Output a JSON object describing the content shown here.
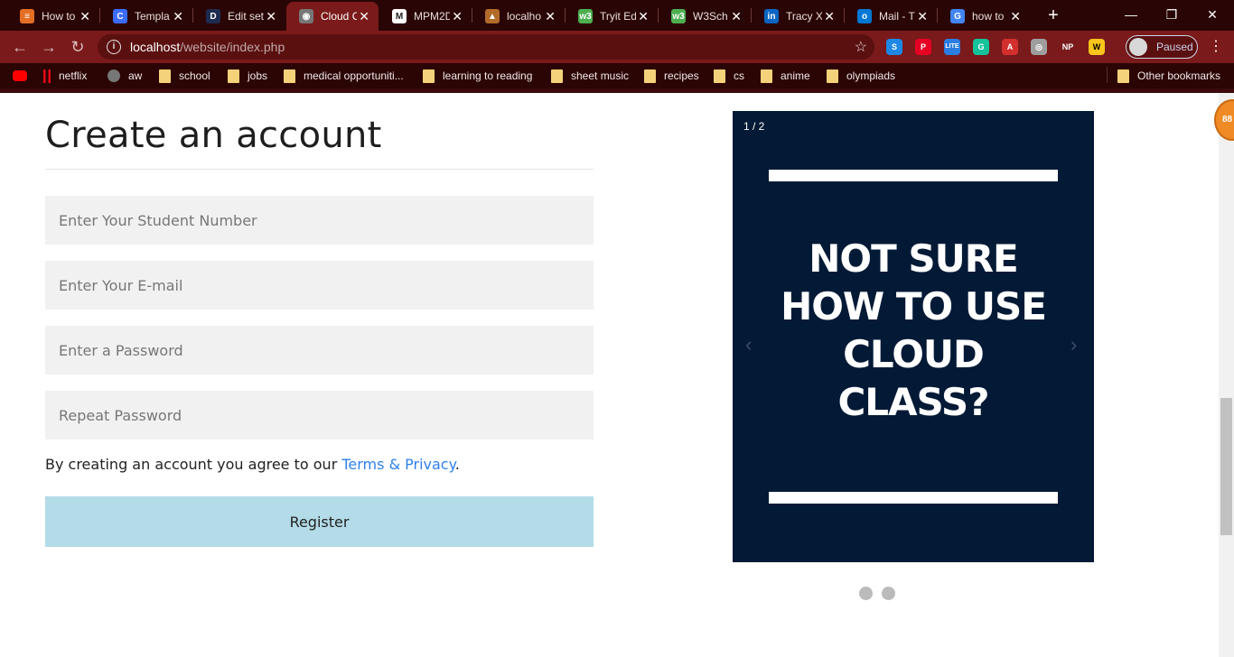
{
  "browser": {
    "tabs": [
      {
        "title": "How to",
        "favicon_color": "#e46e24",
        "glyph": "≡",
        "active": false
      },
      {
        "title": "Templa",
        "favicon_color": "#3b6cff",
        "glyph": "C",
        "active": false
      },
      {
        "title": "Edit set",
        "favicon_color": "#1d2b50",
        "glyph": "D",
        "active": false
      },
      {
        "title": "Cloud C",
        "favicon_color": "#777777",
        "glyph": "◉",
        "active": true
      },
      {
        "title": "MPM2D",
        "favicon_color": "#ffffff",
        "glyph": "M",
        "active": false
      },
      {
        "title": "localho",
        "favicon_color": "#b36b2a",
        "glyph": "▲",
        "active": false
      },
      {
        "title": "Tryit Ed",
        "favicon_color": "#4caf50",
        "glyph": "w3",
        "active": false
      },
      {
        "title": "W3Sch",
        "favicon_color": "#4caf50",
        "glyph": "w3",
        "active": false
      },
      {
        "title": "Tracy X",
        "favicon_color": "#0a66c2",
        "glyph": "in",
        "active": false
      },
      {
        "title": "Mail - T",
        "favicon_color": "#0078d4",
        "glyph": "o",
        "active": false
      },
      {
        "title": "how to",
        "favicon_color": "#4285f4",
        "glyph": "G",
        "active": false
      }
    ],
    "new_tab": "+",
    "window_controls": {
      "minimize": "—",
      "restore": "❐",
      "close": "✕"
    },
    "nav": {
      "back": "←",
      "forward": "→",
      "reload": "↻"
    },
    "url_host": "localhost",
    "url_path": "/website/index.php",
    "star": "☆",
    "extensions": [
      {
        "label": "S",
        "color": "#1e88e5"
      },
      {
        "label": "P",
        "color": "#e60023"
      },
      {
        "label": "LITE",
        "color": "#2a7de1"
      },
      {
        "label": "G",
        "color": "#15c39a"
      },
      {
        "label": "A",
        "color": "#d32f2f"
      },
      {
        "label": "◎",
        "color": "#9e9e9e"
      },
      {
        "label": "NP",
        "color": "#7a1a1a"
      },
      {
        "label": "W",
        "color": "#f9c51b"
      }
    ],
    "profile_label": "Paused",
    "menu": "⋮",
    "bookmarks": [
      {
        "label": "",
        "icon": "yt"
      },
      {
        "label": "netflix",
        "icon": "nf"
      },
      {
        "label": "aw",
        "icon": "globe"
      },
      {
        "label": "school",
        "icon": "folder"
      },
      {
        "label": "jobs",
        "icon": "folder"
      },
      {
        "label": "medical opportuniti...",
        "icon": "folder"
      },
      {
        "label": "learning to reading",
        "icon": "folder"
      },
      {
        "label": "sheet music",
        "icon": "folder"
      },
      {
        "label": "recipes",
        "icon": "folder"
      },
      {
        "label": "cs",
        "icon": "folder"
      },
      {
        "label": "anime",
        "icon": "folder"
      },
      {
        "label": "olympiads",
        "icon": "folder"
      }
    ],
    "other_bookmarks": "Other bookmarks"
  },
  "form": {
    "title": "Create an account",
    "student_number_placeholder": "Enter Your Student Number",
    "email_placeholder": "Enter Your E-mail",
    "password_placeholder": "Enter a Password",
    "repeat_password_placeholder": "Repeat Password",
    "terms_prefix": "By creating an account you agree to our ",
    "terms_link": "Terms & Privacy",
    "terms_suffix": ".",
    "register_label": "Register"
  },
  "slideshow": {
    "counter": "1 / 2",
    "headline_lines": [
      "NOT SURE",
      "HOW TO USE",
      "CLOUD",
      "CLASS?"
    ],
    "prev": "‹",
    "next": "›",
    "dot_count": 2,
    "active_slide": 1
  },
  "badge": "88"
}
